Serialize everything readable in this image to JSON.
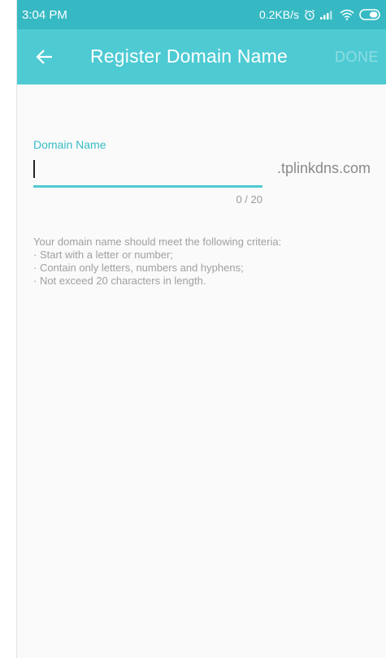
{
  "status_bar": {
    "time": "3:04 PM",
    "network_speed": "0.2KB/s",
    "icons": [
      "alarm-icon",
      "signal-icon",
      "wifi-icon",
      "battery-icon"
    ]
  },
  "app_bar": {
    "back_icon": "arrow-left-icon",
    "title": "Register Domain Name",
    "done_label": "DONE"
  },
  "form": {
    "field_label": "Domain Name",
    "input_value": "",
    "suffix": ".tplinkdns.com",
    "counter": "0 / 20"
  },
  "criteria": {
    "intro": "Your domain name should meet the following criteria:",
    "rules": [
      "· Start with a letter or number;",
      "· Contain only letters, numbers and hyphens;",
      "· Not exceed 20 characters in length."
    ]
  },
  "colors": {
    "status_bar": "#36b9c3",
    "app_bar": "#4ecad3",
    "accent": "#37bcc6",
    "done_disabled": "#8fdde3"
  }
}
